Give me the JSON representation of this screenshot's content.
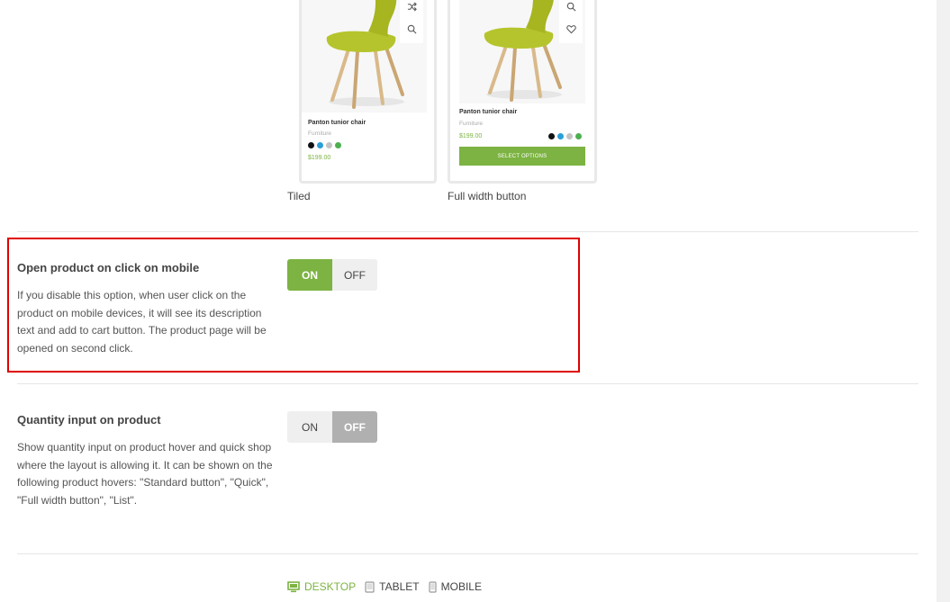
{
  "hover_options": [
    {
      "label": "Tiled",
      "product": {
        "title": "Panton tunior chair",
        "category": "Furniture",
        "price": "$199.00",
        "swatches": [
          "#111111",
          "#2a9fd8",
          "#c4c4c4",
          "#4caf50"
        ]
      },
      "icons": [
        "shuffle-icon",
        "search-icon"
      ]
    },
    {
      "label": "Full width button",
      "product": {
        "title": "Panton tunior chair",
        "category": "Furniture",
        "price": "$199.00",
        "swatches": [
          "#111111",
          "#2a9fd8",
          "#c4c4c4",
          "#4caf50"
        ],
        "button": "SELECT OPTIONS"
      },
      "icons": [
        "search-icon",
        "heart-icon"
      ]
    }
  ],
  "settings": [
    {
      "title": "Open product on click on mobile",
      "description": "If you disable this option, when user click on the product on mobile devices, it will see its description text and add to cart button. The product page will be opened on second click.",
      "on_label": "ON",
      "off_label": "OFF",
      "value": "ON"
    },
    {
      "title": "Quantity input on product",
      "description": "Show quantity input on product hover and quick shop where the layout is allowing it. It can be shown on the following product hovers: \"Standard button\", \"Quick\", \"Full width button\", \"List\".",
      "on_label": "ON",
      "off_label": "OFF",
      "value": "OFF"
    }
  ],
  "devices": {
    "desktop": "DESKTOP",
    "tablet": "TABLET",
    "mobile": "MOBILE",
    "active": "DESKTOP"
  },
  "colors": {
    "accent": "#7cb342",
    "highlight_border": "#e00000",
    "off_active": "#b0b0b0"
  }
}
